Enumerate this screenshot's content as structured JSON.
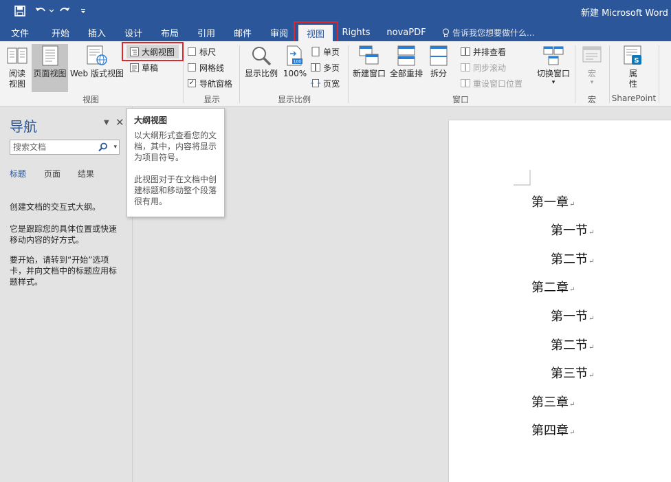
{
  "title": "新建 Microsoft Word 文",
  "qat": {
    "icons": [
      "save-icon",
      "undo-icon",
      "dropdown-icon",
      "redo-icon",
      "customize-icon"
    ]
  },
  "tabs": [
    "文件",
    "开始",
    "插入",
    "设计",
    "布局",
    "引用",
    "邮件",
    "审阅",
    "视图",
    "Rights",
    "novaPDF"
  ],
  "tell_me": "告诉我您想要做什么...",
  "ribbon": {
    "views": {
      "read_mode": "阅读\n视图",
      "read_1": "阅读",
      "read_2": "视图",
      "print_layout": "页面视图",
      "web_layout": "Web 版式视图",
      "outline": "大纲视图",
      "draft": "草稿",
      "group": "视图"
    },
    "show": {
      "ruler": "标尺",
      "gridlines": "网格线",
      "nav_pane": "导航窗格",
      "group": "显示"
    },
    "zoom": {
      "zoom": "显示比例",
      "hundred": "100%",
      "one_page": "单页",
      "multi_page": "多页",
      "page_width": "页宽",
      "group": "显示比例"
    },
    "window": {
      "new_window": "新建窗口",
      "arrange_all": "全部重排",
      "split": "拆分",
      "side_by_side": "并排查看",
      "sync_scroll": "同步滚动",
      "reset_pos": "重设窗口位置",
      "switch_1": "切换窗口",
      "group": "窗口"
    },
    "macros": {
      "label": "宏",
      "group": "宏"
    },
    "sharepoint": {
      "label_1": "属",
      "label_2": "性",
      "group": "SharePoint"
    }
  },
  "nav": {
    "title": "导航",
    "search_placeholder": "搜索文档",
    "tabs": [
      "标题",
      "页面",
      "结果"
    ],
    "text1": "创建文档的交互式大纲。",
    "text2": "它是跟踪您的具体位置或快速移动内容的好方式。",
    "text3": "要开始，请转到“开始”选项卡，并向文档中的标题应用标题样式。"
  },
  "tooltip": {
    "title": "大纲视图",
    "body1": "以大纲形式查看您的文档，其中，内容将显示为项目符号。",
    "body2": "此视图对于在文档中创建标题和移动整个段落很有用。"
  },
  "document": {
    "lines": [
      "第一章",
      "第一节",
      "第二节",
      "第二章",
      "第一节",
      "第二节",
      "第三节",
      "第三章",
      "第四章"
    ],
    "para_mark": "↵"
  },
  "colors": {
    "accent": "#2b579a",
    "highlight_box": "#e0262b"
  }
}
